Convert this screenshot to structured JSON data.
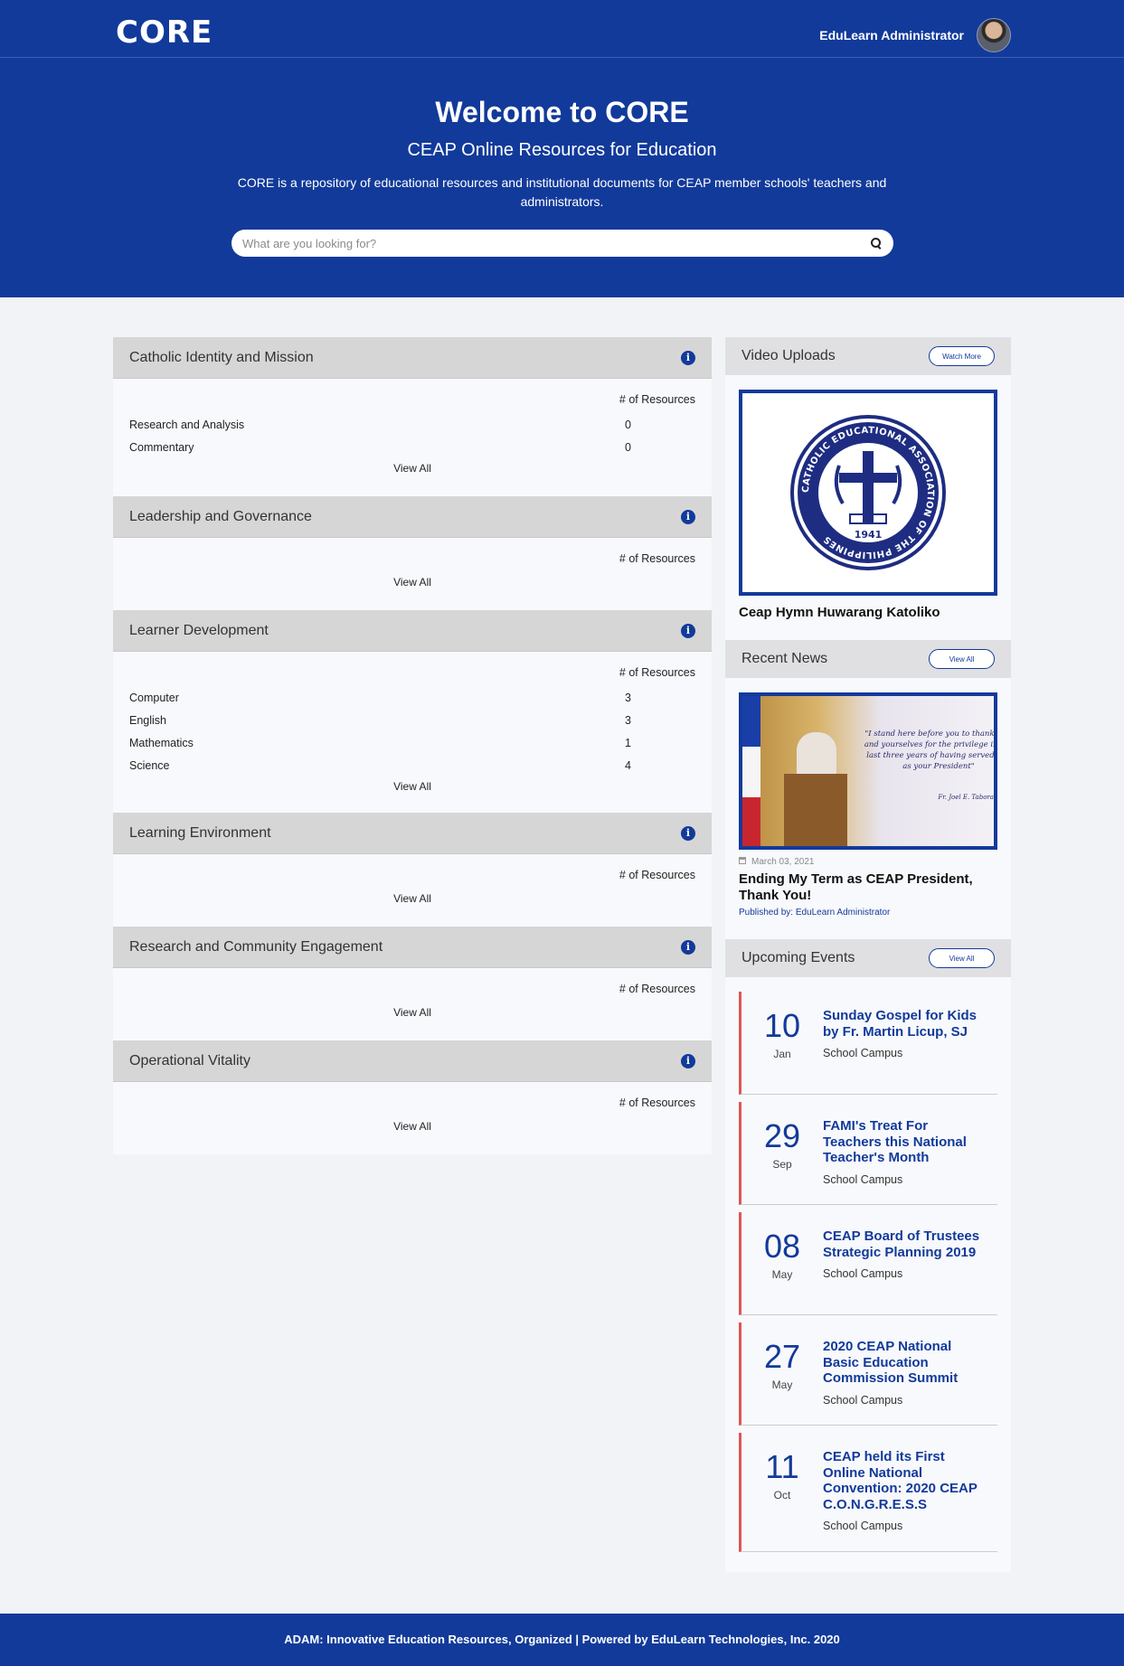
{
  "header": {
    "logo": "CORE",
    "user_name": "EduLearn Administrator"
  },
  "hero": {
    "title": "Welcome to CORE",
    "subtitle": "CEAP Online Resources for Education",
    "description": "CORE is a repository of educational resources and institutional documents for CEAP member schools' teachers and administrators.",
    "search_placeholder": "What are you looking for?"
  },
  "categories": [
    {
      "title": "Catholic Identity and Mission",
      "resources_label": "# of Resources",
      "items": [
        {
          "name": "Research and Analysis",
          "count": "0"
        },
        {
          "name": "Commentary",
          "count": "0"
        }
      ],
      "view_all": "View All"
    },
    {
      "title": "Leadership and Governance",
      "resources_label": "# of Resources",
      "items": [],
      "view_all": "View All"
    },
    {
      "title": "Learner Development",
      "resources_label": "# of Resources",
      "items": [
        {
          "name": "Computer",
          "count": "3"
        },
        {
          "name": "English",
          "count": "3"
        },
        {
          "name": "Mathematics",
          "count": "1"
        },
        {
          "name": "Science",
          "count": "4"
        }
      ],
      "view_all": "View All"
    },
    {
      "title": "Learning Environment",
      "resources_label": "# of Resources",
      "items": [],
      "view_all": "View All"
    },
    {
      "title": "Research and Community Engagement",
      "resources_label": "# of Resources",
      "items": [],
      "view_all": "View All"
    },
    {
      "title": "Operational Vitality",
      "resources_label": "# of Resources",
      "items": [],
      "view_all": "View All"
    }
  ],
  "videos": {
    "title": "Video Uploads",
    "button": "Watch More",
    "video_title": "Ceap Hymn Huwarang Katoliko",
    "seal_text": "CATHOLIC EDUCATIONAL ASSOCIATION OF THE PHILIPPINES",
    "seal_year": "1941"
  },
  "news": {
    "title": "Recent News",
    "button": "View All",
    "quote": "\"I stand here before you to thank God and yourselves for the privilege in the last three years of having served you as your President\"",
    "quote_author": "Fr. Joel E. Tabora, SJ",
    "date": "March 03, 2021",
    "headline": "Ending My Term as CEAP President, Thank You!",
    "published_by": "Published by: EduLearn Administrator"
  },
  "events": {
    "title": "Upcoming Events",
    "button": "View All",
    "items": [
      {
        "day": "10",
        "month": "Jan",
        "title": "Sunday Gospel for Kids by Fr. Martin Licup, SJ",
        "location": "School Campus"
      },
      {
        "day": "29",
        "month": "Sep",
        "title": "FAMI's Treat For Teachers this National Teacher's Month",
        "location": "School Campus"
      },
      {
        "day": "08",
        "month": "May",
        "title": "CEAP Board of Trustees Strategic Planning 2019",
        "location": "School Campus"
      },
      {
        "day": "27",
        "month": "May",
        "title": "2020 CEAP National Basic Education Commission Summit",
        "location": "School Campus"
      },
      {
        "day": "11",
        "month": "Oct",
        "title": "CEAP held its First Online National Convention: 2020 CEAP C.O.N.G.R.E.S.S",
        "location": "School Campus"
      }
    ]
  },
  "footer": {
    "text": "ADAM: Innovative Education Resources, Organized | Powered by EduLearn Technologies, Inc. 2020"
  },
  "colors": {
    "brand": "#123a9a",
    "event_accent": "#e05555"
  }
}
